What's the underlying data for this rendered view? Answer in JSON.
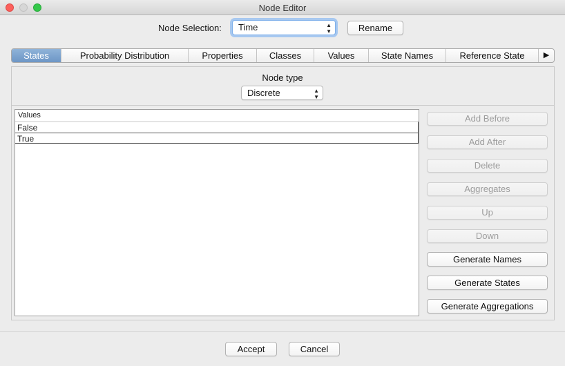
{
  "window": {
    "title": "Node Editor"
  },
  "node_selection": {
    "label": "Node Selection:",
    "value": "Time",
    "rename_label": "Rename"
  },
  "tabs": [
    {
      "label": "States",
      "active": true
    },
    {
      "label": "Probability Distribution"
    },
    {
      "label": "Properties"
    },
    {
      "label": "Classes"
    },
    {
      "label": "Values"
    },
    {
      "label": "State Names"
    },
    {
      "label": "Reference State"
    },
    {
      "label": "▶",
      "icon": "tab-scroll-right-icon"
    }
  ],
  "node_type": {
    "label": "Node type",
    "value": "Discrete"
  },
  "states_table": {
    "header": "Values",
    "rows": [
      "False",
      "True"
    ]
  },
  "side_buttons": [
    {
      "label": "Add Before",
      "enabled": false
    },
    {
      "label": "Add After",
      "enabled": false
    },
    {
      "label": "Delete",
      "enabled": false
    },
    {
      "label": "Aggregates",
      "enabled": false
    },
    {
      "label": "Up",
      "enabled": false
    },
    {
      "label": "Down",
      "enabled": false
    },
    {
      "label": "Generate Names",
      "enabled": true
    },
    {
      "label": "Generate States",
      "enabled": true
    },
    {
      "label": "Generate Aggregations",
      "enabled": true
    }
  ],
  "footer": {
    "accept_label": "Accept",
    "cancel_label": "Cancel"
  },
  "colors": {
    "close": "#fc605c",
    "minimize": "#d7d7d7",
    "maximize": "#34c84a",
    "active_tab": "#7ea5cf",
    "focus_ring": "#a7c8f0"
  }
}
